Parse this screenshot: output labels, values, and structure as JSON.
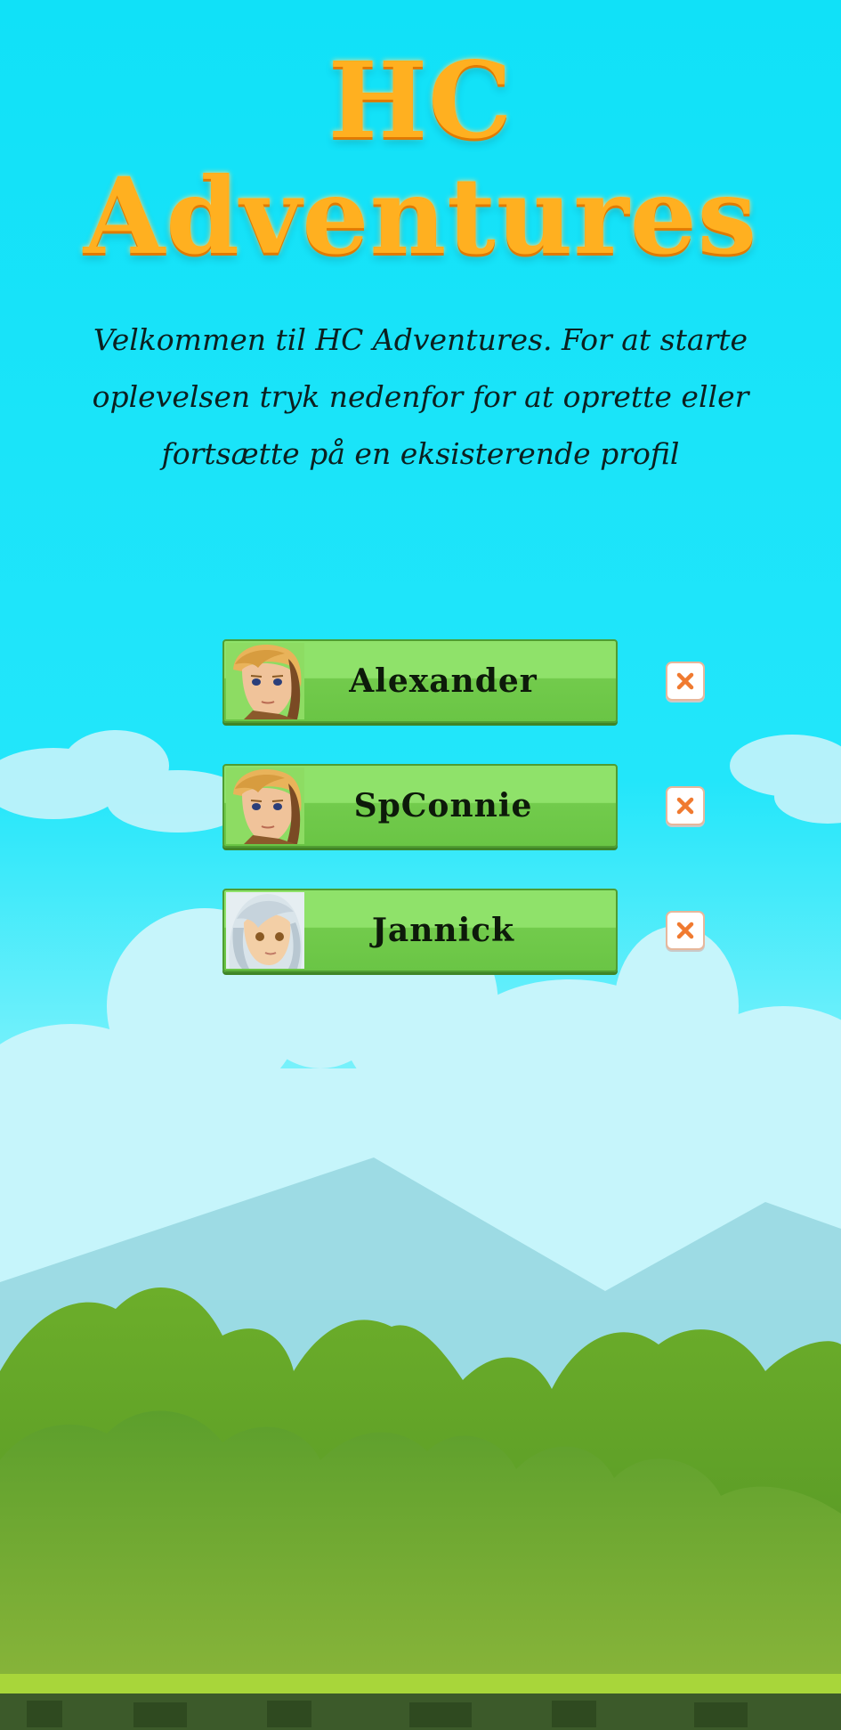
{
  "app": {
    "title": "HC Adventures",
    "intro": "Velkommen til HC Adventures. For at starte oplevelsen tryk nedenfor for at oprette eller fortsætte på en eksisterende profil"
  },
  "profiles": [
    {
      "name": "Alexander",
      "avatar": "boy-avatar-icon"
    },
    {
      "name": "SpConnie",
      "avatar": "boy-avatar-icon"
    },
    {
      "name": "Jannick",
      "avatar": "girl-avatar-icon"
    }
  ],
  "icons": {
    "delete": "close-icon"
  },
  "colors": {
    "sky": "#12e2f8",
    "title": "#ffb020",
    "button_green": "#8fe26a",
    "delete_x": "#f07a30"
  }
}
